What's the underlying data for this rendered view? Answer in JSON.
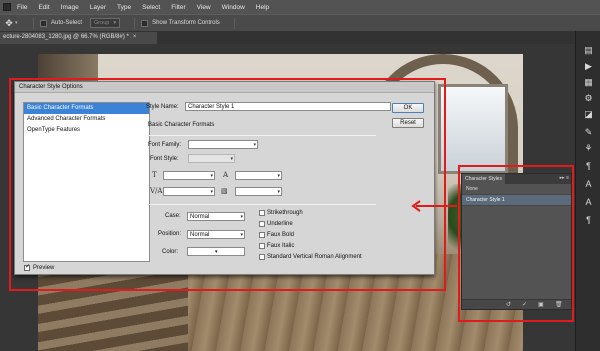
{
  "menubar": {
    "items": [
      "File",
      "Edit",
      "Image",
      "Layer",
      "Type",
      "Select",
      "Filter",
      "View",
      "Window",
      "Help"
    ]
  },
  "options_bar": {
    "auto_select_label": "Auto-Select",
    "auto_select_dropdown": "Group",
    "show_transform_label": "Show Transform Controls"
  },
  "document_tab": {
    "title": "ecture-2804083_1280.jpg @ 66.7% (RGB/8#) *",
    "close_glyph": "×"
  },
  "annotation": {
    "box_color": "#e01b1b"
  },
  "dialog": {
    "title": "Character Style Options",
    "sidebar_items": [
      "Basic Character Formats",
      "Advanced Character Formats",
      "OpenType Features"
    ],
    "selected_index": 0,
    "preview_label": "Preview",
    "preview_checked": true,
    "style_name_label": "Style Name:",
    "style_name_value": "Character Style 1",
    "section_heading": "Basic Character Formats",
    "ok_label": "OK",
    "cancel_label": "Reset",
    "font_family_label": "Font Family:",
    "font_family_value": "",
    "font_style_label": "Font Style:",
    "font_style_value": "",
    "case_label": "Case:",
    "case_value": "Normal",
    "position_label": "Position:",
    "position_value": "Normal",
    "color_label": "Color:",
    "color_value": "",
    "checkbox_options": [
      "Strikethrough",
      "Underline",
      "Faux Bold",
      "Faux Italic",
      "Standard Vertical Roman Alignment"
    ]
  },
  "panel": {
    "tab_label": "Character Styles",
    "rows": [
      "None",
      "Character Style 1"
    ],
    "selected_row": 1,
    "menu_glyph": "▸▸ ≡"
  }
}
